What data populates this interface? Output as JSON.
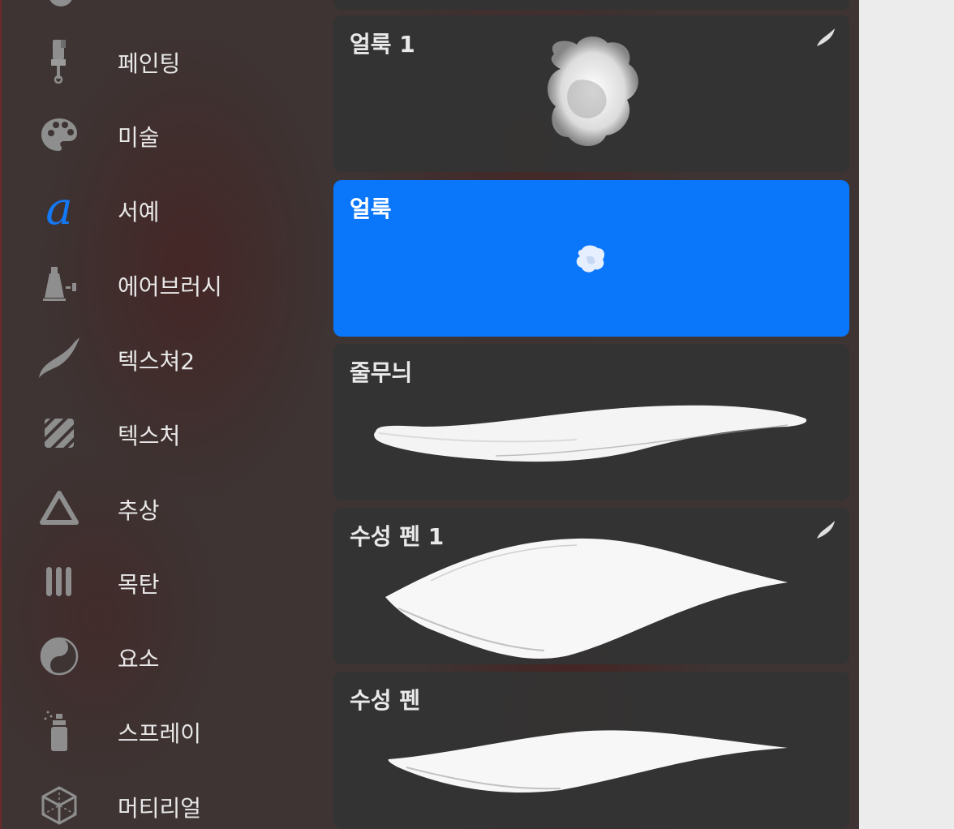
{
  "sidebar": {
    "items": [
      {
        "label": "페인팅",
        "icon": "paint-brush-icon"
      },
      {
        "label": "미술",
        "icon": "palette-icon"
      },
      {
        "label": "서예",
        "icon": "calligraphy-a-icon",
        "active": true
      },
      {
        "label": "에어브러시",
        "icon": "airbrush-icon"
      },
      {
        "label": "텍스쳐2",
        "icon": "swoosh-icon"
      },
      {
        "label": "텍스처",
        "icon": "texture-hatch-icon"
      },
      {
        "label": "추상",
        "icon": "triangle-icon"
      },
      {
        "label": "목탄",
        "icon": "charcoal-sticks-icon"
      },
      {
        "label": "요소",
        "icon": "yin-yang-icon"
      },
      {
        "label": "스프레이",
        "icon": "spray-can-icon"
      },
      {
        "label": "머티리얼",
        "icon": "cube-icon"
      }
    ]
  },
  "brushes": [
    {
      "name": "얼룩 1",
      "imported": true
    },
    {
      "name": "얼룩",
      "selected": true
    },
    {
      "name": "줄무늬"
    },
    {
      "name": "수성 펜 1",
      "imported": true
    },
    {
      "name": "수성 펜"
    }
  ],
  "colors": {
    "accent": "#0A76FA",
    "active_icon": "#1479F5",
    "icon": "#8E8E8E",
    "label": "#E8E8E8",
    "card": "#343434"
  }
}
